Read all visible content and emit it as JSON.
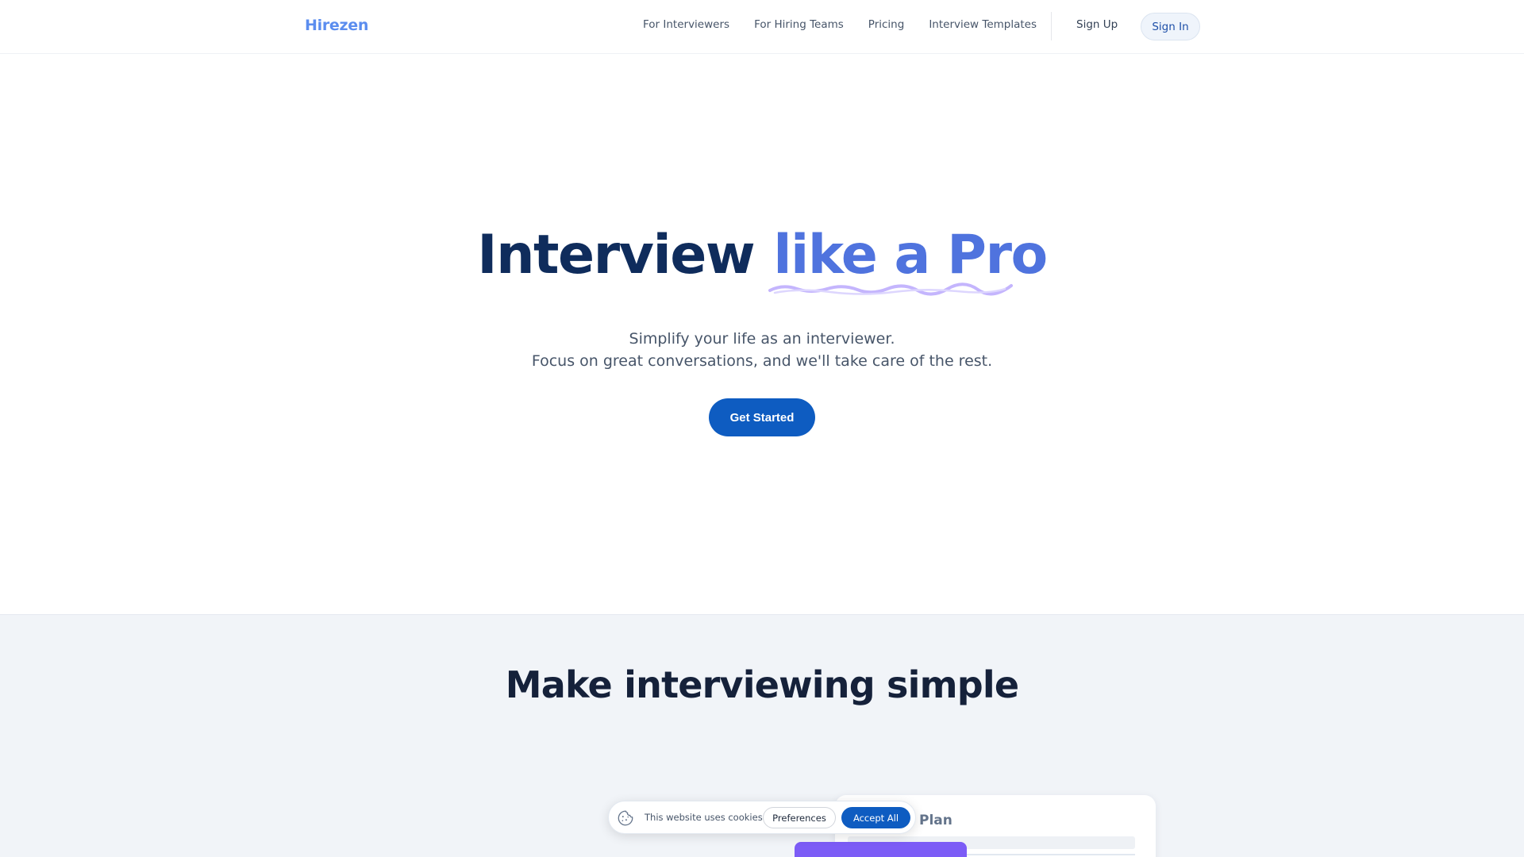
{
  "nav": {
    "logo": "Hirezen",
    "links": [
      "For Interviewers",
      "For Hiring Teams",
      "Pricing",
      "Interview Templates"
    ],
    "sign_up": "Sign Up",
    "sign_in": "Sign In"
  },
  "hero": {
    "title_plain": "Interview",
    "title_accent": "like a Pro",
    "subtitle_line1": "Simplify your life as an interviewer.",
    "subtitle_line2": "Focus on great conversations, and we'll take care of the rest.",
    "cta": "Get Started"
  },
  "section2": {
    "title": "Make interviewing simple",
    "card_title": "Plan"
  },
  "cookie_banner": {
    "icon": "cookie-icon",
    "text": "This website uses cookies",
    "preferences": "Preferences",
    "accept_all": "Accept All"
  },
  "colors": {
    "brand": "#5b8def",
    "navy": "#0f2c5c",
    "accent": "#4f73de",
    "cta": "#0e5cc1",
    "squiggle": "#c4b5fd",
    "section_bg": "#f1f4f8",
    "purple": "#7c5cf6"
  }
}
